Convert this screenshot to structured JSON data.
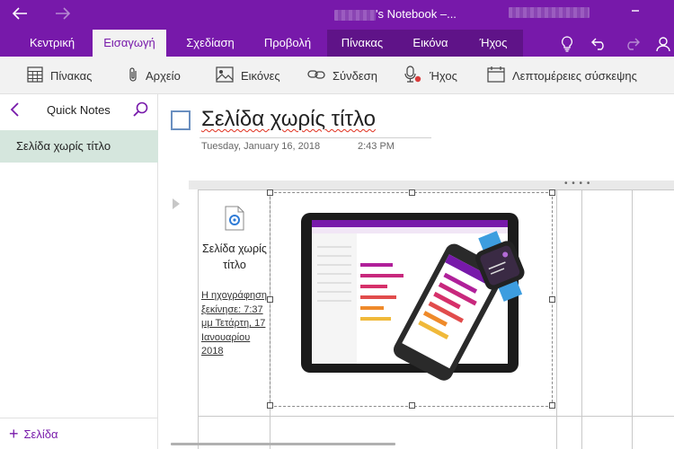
{
  "titlebar": {
    "title": "'s Notebook –...",
    "back_icon": "arrow-left-icon",
    "forward_icon": "arrow-right-icon"
  },
  "ribbon": {
    "tabs": [
      {
        "label": "Κεντρική"
      },
      {
        "label": "Εισαγωγή"
      },
      {
        "label": "Σχεδίαση"
      },
      {
        "label": "Προβολή"
      },
      {
        "label": "Πίνακας"
      },
      {
        "label": "Εικόνα"
      },
      {
        "label": "Ήχος"
      }
    ],
    "active_tab": "Εισαγωγή"
  },
  "toolbar": {
    "items": [
      {
        "label": "Πίνακας",
        "icon": "table-icon"
      },
      {
        "label": "Αρχείο",
        "icon": "paperclip-icon"
      },
      {
        "label": "Εικόνες",
        "icon": "picture-icon"
      },
      {
        "label": "Σύνδεση",
        "icon": "link-icon"
      },
      {
        "label": "Ήχος",
        "icon": "microphone-icon"
      },
      {
        "label": "Λεπτομέρειες σύσκεψης",
        "icon": "calendar-icon"
      }
    ]
  },
  "sidebar": {
    "section": "Quick Notes",
    "pages": [
      {
        "label": "Σελίδα χωρίς τίτλο",
        "selected": true
      }
    ],
    "add_page": "Σελίδα"
  },
  "page": {
    "title": "Σελίδα χωρίς τίτλο",
    "date": "Tuesday, January 16, 2018",
    "time": "2:43 PM",
    "attachment_name": "Σελίδα χωρίς τίτλο",
    "recording_note": "Η ηχογράφηση ξεκίνησε: 7:37 μμ Τετάρτη, 17 Ιανουαρίου 2018"
  },
  "colors": {
    "brand": "#7719aa",
    "selected_page": "#d5e6dd"
  }
}
